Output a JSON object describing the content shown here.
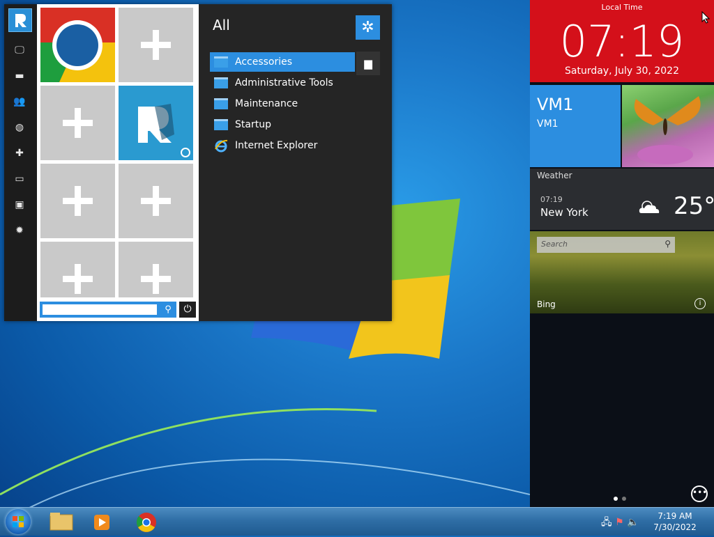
{
  "start_menu": {
    "search": {
      "value": "",
      "placeholder": ""
    },
    "heading": "All",
    "apps": [
      {
        "label": "Accessories",
        "type": "folder",
        "selected": true
      },
      {
        "label": "Administrative Tools",
        "type": "folder"
      },
      {
        "label": "Maintenance",
        "type": "folder"
      },
      {
        "label": "Startup",
        "type": "folder"
      },
      {
        "label": "Internet Explorer",
        "type": "ie"
      }
    ],
    "left_bar_icons": [
      "monitor-icon",
      "folder-icon",
      "users-icon",
      "globe-icon",
      "puzzle-icon",
      "chart-icon",
      "window-icon",
      "gear-icon"
    ]
  },
  "side_panel": {
    "clock": {
      "title": "Local Time",
      "time": "07:19",
      "date": "Saturday, July 30, 2022"
    },
    "vm": {
      "name": "VM1",
      "subtitle": "VM1"
    },
    "weather": {
      "title": "Weather",
      "time": "07:19",
      "city": "New York",
      "temp": "25°"
    },
    "bing": {
      "placeholder": "Search",
      "label": "Bing"
    }
  },
  "taskbar": {
    "time": "7:19 AM",
    "date": "7/30/2022"
  },
  "colors": {
    "accent": "#2c8ee0",
    "clock_bg": "#d4101a"
  }
}
